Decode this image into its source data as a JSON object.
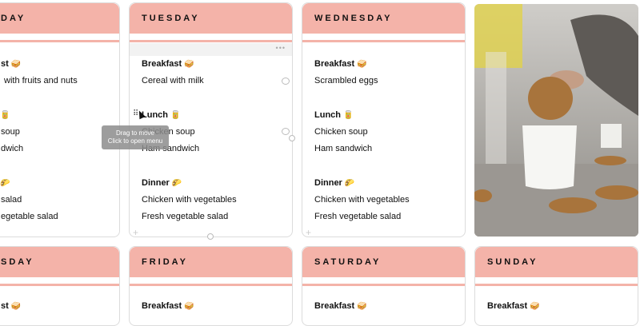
{
  "colors": {
    "header": "#f4b3a9",
    "card_border": "#dcdcdc"
  },
  "cards": {
    "monday": {
      "day": "DAY",
      "breakfast_title": "st",
      "breakfast_1": "with fruits and nuts",
      "lunch_1": "soup",
      "lunch_2": "dwich",
      "dinner_1": "salad",
      "dinner_2": "egetable salad"
    },
    "tuesday": {
      "day": "TUESDAY",
      "breakfast_title": "Breakfast",
      "breakfast_1": "Cereal with milk",
      "lunch_title": "Lunch",
      "lunch_1": "Chicken soup",
      "lunch_2": "Ham sandwich",
      "dinner_title": "Dinner",
      "dinner_1": "Chicken with vegetables",
      "dinner_2": "Fresh vegetable salad"
    },
    "wednesday": {
      "day": "WEDNESDAY",
      "breakfast_title": "Breakfast",
      "breakfast_1": "Scrambled eggs",
      "lunch_title": "Lunch",
      "lunch_1": "Chicken soup",
      "lunch_2": "Ham sandwich",
      "dinner_title": "Dinner",
      "dinner_1": "Chicken with vegetables",
      "dinner_2": "Fresh vegetable salad"
    },
    "thursday": {
      "day": "SDAY",
      "breakfast_title": "st"
    },
    "friday": {
      "day": "FRIDAY",
      "breakfast_title": "Breakfast"
    },
    "saturday": {
      "day": "SATURDAY",
      "breakfast_title": "Breakfast"
    },
    "sunday": {
      "day": "SUNDAY",
      "breakfast_title": "Breakfast"
    }
  },
  "emojis": {
    "breakfast": "🥪",
    "lunch": "🥫",
    "dinner": "🌮"
  },
  "tooltip": {
    "line1": "Drag to move",
    "line2": "Click to open menu"
  },
  "icons": {
    "dots": "•••",
    "drag": "⠿",
    "plus": "+"
  }
}
